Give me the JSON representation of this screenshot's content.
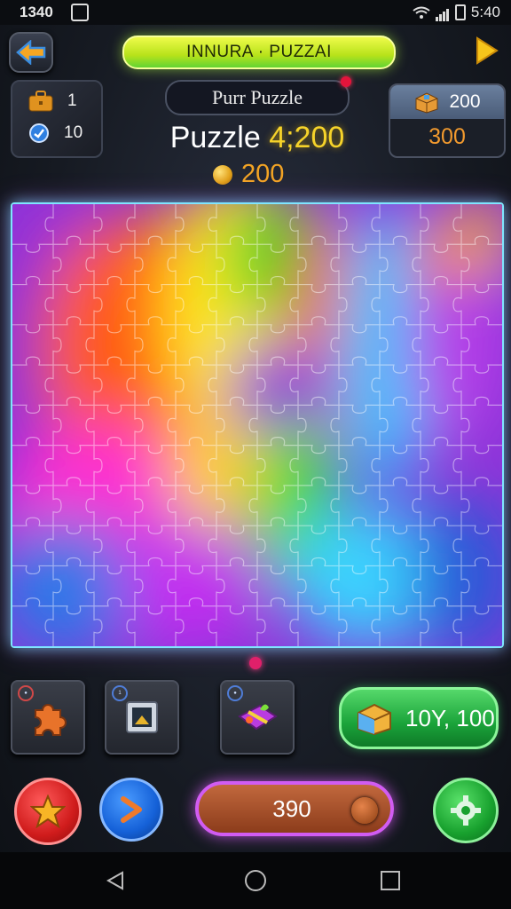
{
  "status_bar": {
    "time_left": "1340",
    "time_right": "5:40"
  },
  "header": {
    "title": "INNURA · PUZZAI"
  },
  "left_panel": {
    "bag_count": "1",
    "tokens_value": "10"
  },
  "subtitle": "Purr Puzzle",
  "puzzle_label": "Puzzle",
  "puzzle_score": "4;200",
  "coins": "200",
  "box_panel": {
    "top_value": "200",
    "bottom_value": "300"
  },
  "tools": [
    {
      "name": "piece",
      "badge": ""
    },
    {
      "name": "frame",
      "badge": "1"
    },
    {
      "name": "gift",
      "badge": ""
    }
  ],
  "reward_button": {
    "label": "10Y, 100"
  },
  "progress_value": "390",
  "colors": {
    "title_green": "#b7e21a",
    "score_gold": "#f6d32a",
    "coin_orange": "#f3a424",
    "board_glow": "#7fe5ff",
    "pill_purple": "#d15cf2"
  },
  "icons": [
    "back-arrow-icon",
    "play-arrow-icon",
    "briefcase-icon",
    "token-icon",
    "box-icon",
    "coin-icon",
    "puzzle-piece-icon",
    "frame-icon",
    "gift-icon",
    "treasure-box-icon",
    "star-icon",
    "chevron-right-icon",
    "gear-icon",
    "nav-back-icon",
    "nav-home-icon",
    "nav-recents-icon",
    "wifi-icon",
    "signal-icon",
    "battery-icon"
  ]
}
